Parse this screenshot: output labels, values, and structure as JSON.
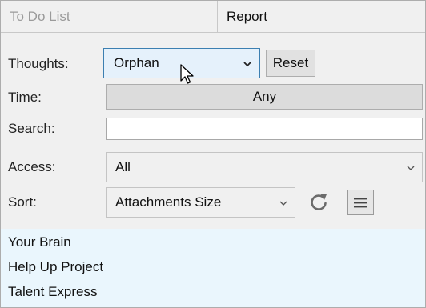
{
  "tabs": {
    "todo": "To Do List",
    "report": "Report"
  },
  "labels": {
    "thoughts": "Thoughts:",
    "time": "Time:",
    "search": "Search:",
    "access": "Access:",
    "sort": "Sort:"
  },
  "thoughts": {
    "selected": "Orphan"
  },
  "reset_button": "Reset",
  "time": {
    "value": "Any"
  },
  "search": {
    "value": ""
  },
  "access": {
    "selected": "All"
  },
  "sort": {
    "selected": "Attachments Size"
  },
  "icons": {
    "refresh": "refresh-icon",
    "menu": "menu-icon"
  },
  "results": [
    "Your Brain",
    "Help Up Project",
    "Talent Express"
  ],
  "colors": {
    "panel_bg": "#f0f0f0",
    "results_bg": "#eaf6fd",
    "focus_border": "#3c7fb1",
    "focus_bg": "#e5f1fb"
  }
}
